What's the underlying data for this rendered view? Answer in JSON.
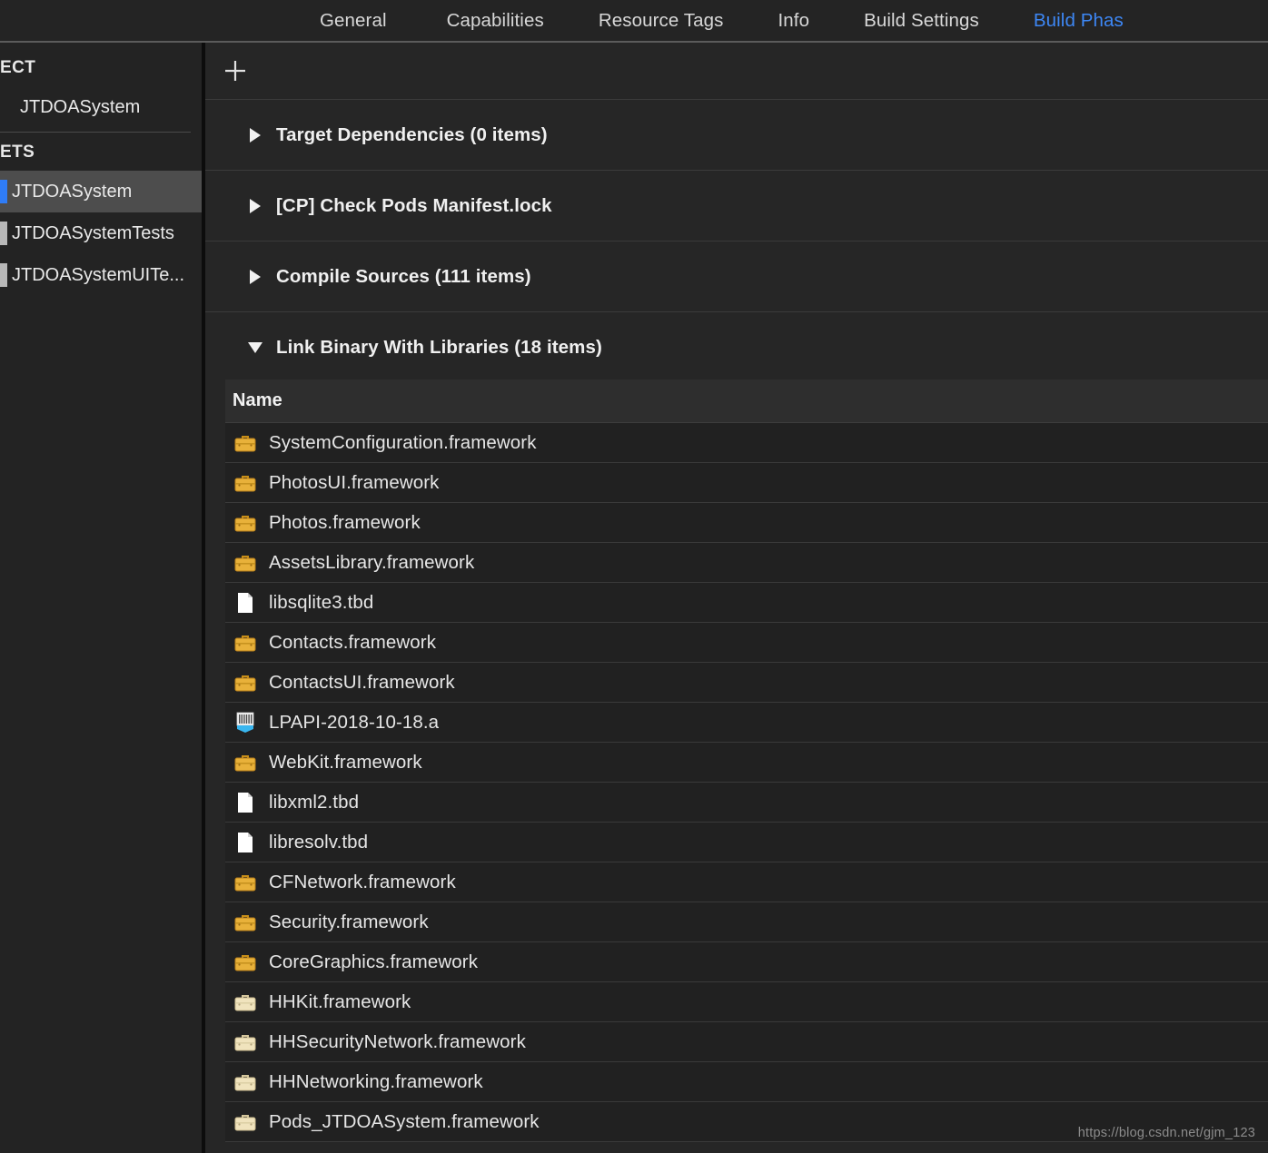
{
  "tabbar": {
    "tabs": [
      {
        "label": "General",
        "active": false
      },
      {
        "label": "Capabilities",
        "active": false
      },
      {
        "label": "Resource Tags",
        "active": false
      },
      {
        "label": "Info",
        "active": false
      },
      {
        "label": "Build Settings",
        "active": false
      },
      {
        "label": "Build Phas",
        "active": true
      }
    ],
    "active_color": "#3d87f5",
    "inactive_color": "#d8d8d8"
  },
  "sidebar": {
    "project_header": "ECT",
    "targets_header": "ETS",
    "project_items": [
      {
        "label": "JTDOASystem",
        "marker": "none",
        "selected": false
      }
    ],
    "target_items": [
      {
        "label": "JTDOASystem",
        "marker": "blue",
        "selected": true
      },
      {
        "label": "JTDOASystemTests",
        "marker": "gray",
        "selected": false
      },
      {
        "label": "JTDOASystemUITe...",
        "marker": "gray",
        "selected": false
      }
    ],
    "selection_color": "#4d4d4d",
    "accent_color": "#2f7cf6"
  },
  "toolbar": {
    "add_button_label": "+",
    "add_icon": "plus-icon"
  },
  "phases": [
    {
      "title": "Target Dependencies (0 items)",
      "expanded": false,
      "icon": "chevron-right-icon"
    },
    {
      "title": "[CP] Check Pods Manifest.lock",
      "expanded": false,
      "icon": "chevron-right-icon"
    },
    {
      "title": "Compile Sources (111 items)",
      "expanded": false,
      "icon": "chevron-right-icon"
    },
    {
      "title": "Link Binary With Libraries (18 items)",
      "expanded": true,
      "icon": "chevron-down-icon"
    }
  ],
  "table": {
    "columns": [
      "Name"
    ],
    "rows": [
      {
        "name": "SystemConfiguration.framework",
        "icon": "framework-icon"
      },
      {
        "name": "PhotosUI.framework",
        "icon": "framework-icon"
      },
      {
        "name": "Photos.framework",
        "icon": "framework-icon"
      },
      {
        "name": "AssetsLibrary.framework",
        "icon": "framework-icon"
      },
      {
        "name": "libsqlite3.tbd",
        "icon": "tbd-document-icon"
      },
      {
        "name": "Contacts.framework",
        "icon": "framework-icon"
      },
      {
        "name": "ContactsUI.framework",
        "icon": "framework-icon"
      },
      {
        "name": "LPAPI-2018-10-18.a",
        "icon": "static-library-icon"
      },
      {
        "name": "WebKit.framework",
        "icon": "framework-icon"
      },
      {
        "name": "libxml2.tbd",
        "icon": "tbd-document-icon"
      },
      {
        "name": "libresolv.tbd",
        "icon": "tbd-document-icon"
      },
      {
        "name": "CFNetwork.framework",
        "icon": "framework-icon"
      },
      {
        "name": "Security.framework",
        "icon": "framework-icon"
      },
      {
        "name": "CoreGraphics.framework",
        "icon": "framework-icon"
      },
      {
        "name": "HHKit.framework",
        "icon": "custom-framework-icon"
      },
      {
        "name": "HHSecurityNetwork.framework",
        "icon": "custom-framework-icon"
      },
      {
        "name": "HHNetworking.framework",
        "icon": "custom-framework-icon"
      },
      {
        "name": "Pods_JTDOASystem.framework",
        "icon": "custom-framework-icon"
      }
    ]
  },
  "watermark": {
    "text": "https://blog.csdn.net/gjm_123"
  },
  "colors": {
    "background": "#212121",
    "panel": "#262626",
    "header_row": "#2e2e2e",
    "separator": "#3b3b3b",
    "text": "#e6e6e6",
    "framework_gold": "#e8b13a",
    "framework_cream": "#f0e3bd",
    "library_blue": "#39b6ef"
  }
}
